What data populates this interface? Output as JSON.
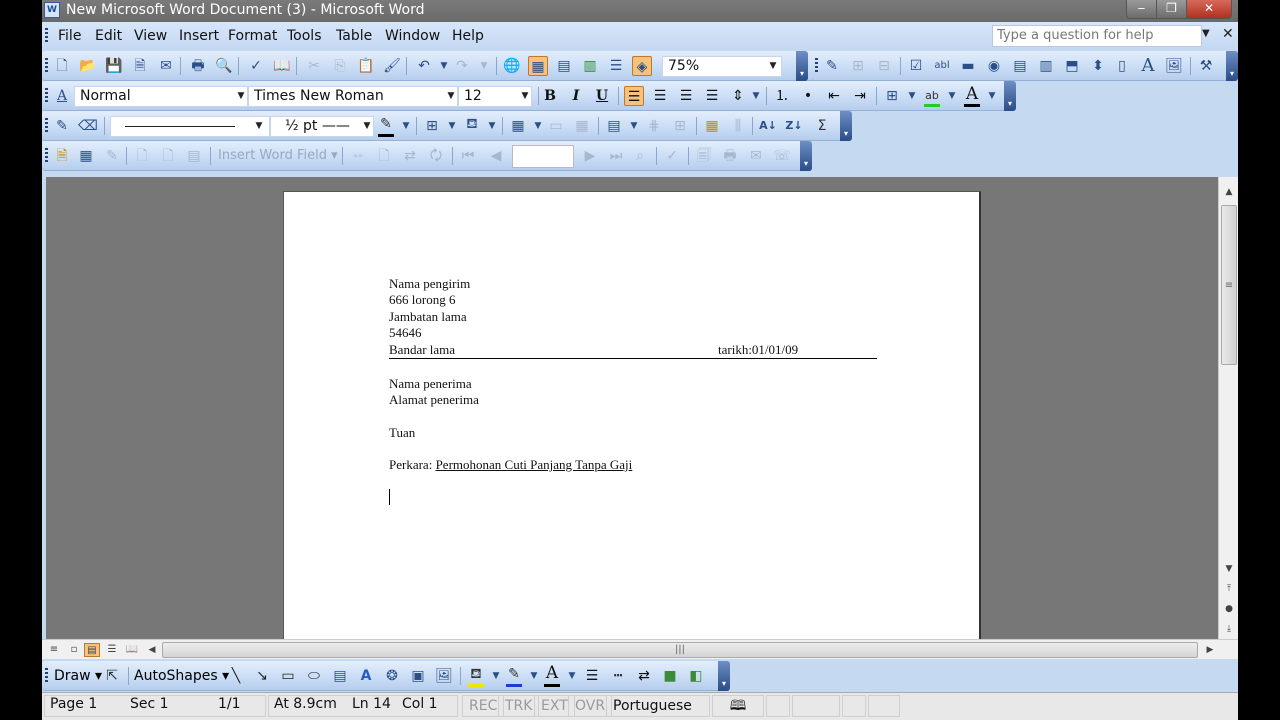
{
  "window": {
    "title": "New Microsoft Word Document (3) - Microsoft Word",
    "app_icon": "word-icon",
    "controls": {
      "minimize": "‒",
      "restore": "❐",
      "close": "✕"
    }
  },
  "menu": {
    "items": [
      "File",
      "Edit",
      "View",
      "Insert",
      "Format",
      "Tools",
      "Table",
      "Window",
      "Help"
    ],
    "help_placeholder": "Type a question for help",
    "help_close": "✕",
    "help_dropdown": "▼"
  },
  "standard_toolbar": {
    "zoom": "75%",
    "icons": [
      "new-document",
      "open",
      "save",
      "permission",
      "email",
      "print",
      "print-preview",
      "spelling",
      "research",
      "cut",
      "copy",
      "paste",
      "format-painter",
      "undo",
      "redo",
      "insert-hyperlink",
      "tables-borders",
      "insert-table",
      "insert-excel",
      "columns",
      "drawing",
      "zoom"
    ]
  },
  "forms_toolbar": {
    "icons": [
      "draw-table-forms",
      "text-form-field-disabled",
      "check-box-field",
      "text-form-field",
      "drop-down-field",
      "option-button",
      "frame",
      "frame-2",
      "scroll-bar",
      "spin-button",
      "scroll-control",
      "text-label",
      "image",
      "properties"
    ]
  },
  "formatting_toolbar": {
    "style": "Normal",
    "font": "Times New Roman",
    "size": "12",
    "bold": "B",
    "italic": "I",
    "underline": "U",
    "highlight_color": "#22cc22",
    "font_color": "#000000"
  },
  "tables_toolbar": {
    "line_style": "",
    "line_weight": "½ pt",
    "border_color": "#000000",
    "shading_color": "#ffffff",
    "sum": "Σ"
  },
  "mail_merge_toolbar": {
    "insert_word_field": "Insert Word Field",
    "record_number": ""
  },
  "document": {
    "sender": [
      "Nama pengirim",
      "666 lorong 6",
      "Jambatan lama",
      "54646",
      "Bandar lama"
    ],
    "date": "tarikh:01/01/09",
    "recipient": [
      "Nama penerima",
      "Alamat penerima"
    ],
    "salutation": "Tuan",
    "subject_label": "Perkara: ",
    "subject": "Permohonan Cuti Panjang Tanpa Gaji"
  },
  "view_buttons": [
    "normal-view",
    "web-layout-view",
    "print-layout-view",
    "outline-view",
    "reading-layout-view"
  ],
  "drawing_toolbar": {
    "draw": "Draw",
    "autoshapes": "AutoShapes",
    "fill_color": "#f5e400",
    "line_color": "#1a3fd0",
    "font_color": "#000000"
  },
  "status_bar": {
    "page": "Page 1",
    "section": "Sec 1",
    "pages": "1/1",
    "at": "At 8.9cm",
    "line": "Ln 14",
    "col": "Col 1",
    "rec": "REC",
    "trk": "TRK",
    "ext": "EXT",
    "ovr": "OVR",
    "language": "Portuguese"
  }
}
